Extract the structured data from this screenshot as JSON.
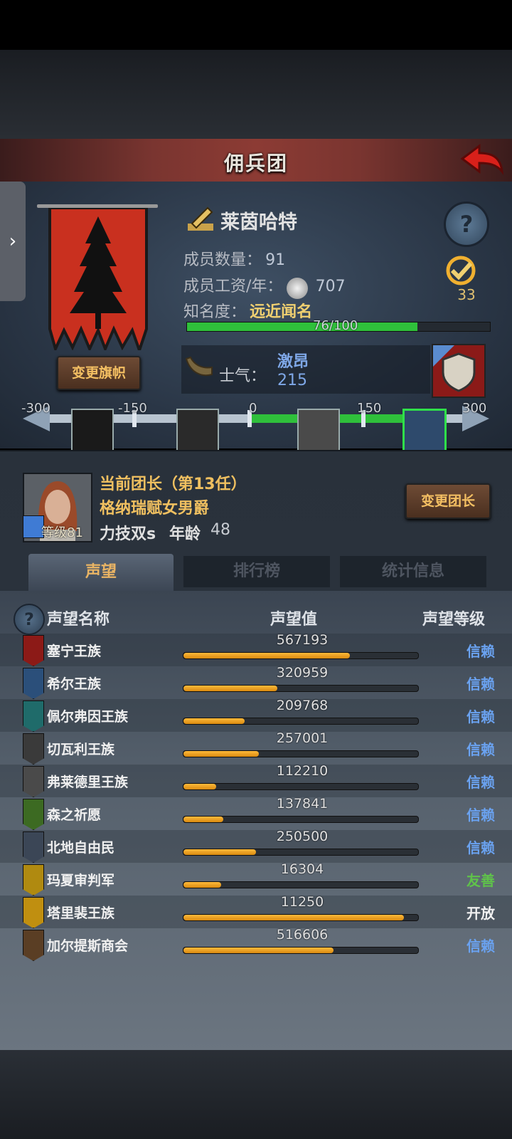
{
  "header": {
    "title": "佣兵团"
  },
  "company": {
    "name": "莱茵哈特",
    "members_label": "成员数量：",
    "members_value": "91",
    "wage_label": "成员工资/年：",
    "wage_value": "707",
    "fame_label": "知名度：",
    "fame_value": "远近闻名",
    "fame_progress_text": "76/100",
    "fame_progress": 0.76,
    "badge_count": "33",
    "change_banner_label": "变更旗帜"
  },
  "morale": {
    "label": "士气：",
    "state": "激昂",
    "value": "215",
    "scale_labels": [
      "-300",
      "-150",
      "0",
      "150",
      "300"
    ]
  },
  "leader": {
    "title": "当前团长（第13任）",
    "name": "格纳瑞赋女男爵",
    "trait": "力技双s",
    "age_label": "年龄",
    "age": "48",
    "level": "等级81",
    "change_leader_label": "变更团长"
  },
  "tabs": [
    {
      "label": "声望"
    },
    {
      "label": "排行榜"
    },
    {
      "label": "统计信息"
    }
  ],
  "table": {
    "col_name": "声望名称",
    "col_value": "声望值",
    "col_level": "声望等级",
    "rows": [
      {
        "name": "塞宁王族",
        "value": "567193",
        "level": "信赖",
        "fill": 0.71,
        "icon_color": "#8c1a17",
        "level_color": "#6aa2f0"
      },
      {
        "name": "希尔王族",
        "value": "320959",
        "level": "信赖",
        "fill": 0.4,
        "icon_color": "#2b4f7a",
        "level_color": "#6aa2f0"
      },
      {
        "name": "佩尔弗因王族",
        "value": "209768",
        "level": "信赖",
        "fill": 0.26,
        "icon_color": "#1f6b6a",
        "level_color": "#6aa2f0"
      },
      {
        "name": "切瓦利王族",
        "value": "257001",
        "level": "信赖",
        "fill": 0.32,
        "icon_color": "#3a3a3a",
        "level_color": "#6aa2f0"
      },
      {
        "name": "弗莱德里王族",
        "value": "112210",
        "level": "信赖",
        "fill": 0.14,
        "icon_color": "#4a4a4a",
        "level_color": "#6aa2f0"
      },
      {
        "name": "森之祈愿",
        "value": "137841",
        "level": "信赖",
        "fill": 0.17,
        "icon_color": "#3c6a22",
        "level_color": "#6aa2f0"
      },
      {
        "name": "北地自由民",
        "value": "250500",
        "level": "信赖",
        "fill": 0.31,
        "icon_color": "#3b4656",
        "level_color": "#6aa2f0"
      },
      {
        "name": "玛夏审判军",
        "value": "16304",
        "level": "友善",
        "fill": 0.16,
        "icon_color": "#b08a10",
        "level_color": "#5fc24a"
      },
      {
        "name": "塔里裴王族",
        "value": "11250",
        "level": "开放",
        "fill": 0.94,
        "icon_color": "#c08f10",
        "level_color": "#f0f0f0"
      },
      {
        "name": "加尔提斯商会",
        "value": "516606",
        "level": "信赖",
        "fill": 0.64,
        "icon_color": "#5a3e24",
        "level_color": "#6aa2f0"
      }
    ]
  }
}
